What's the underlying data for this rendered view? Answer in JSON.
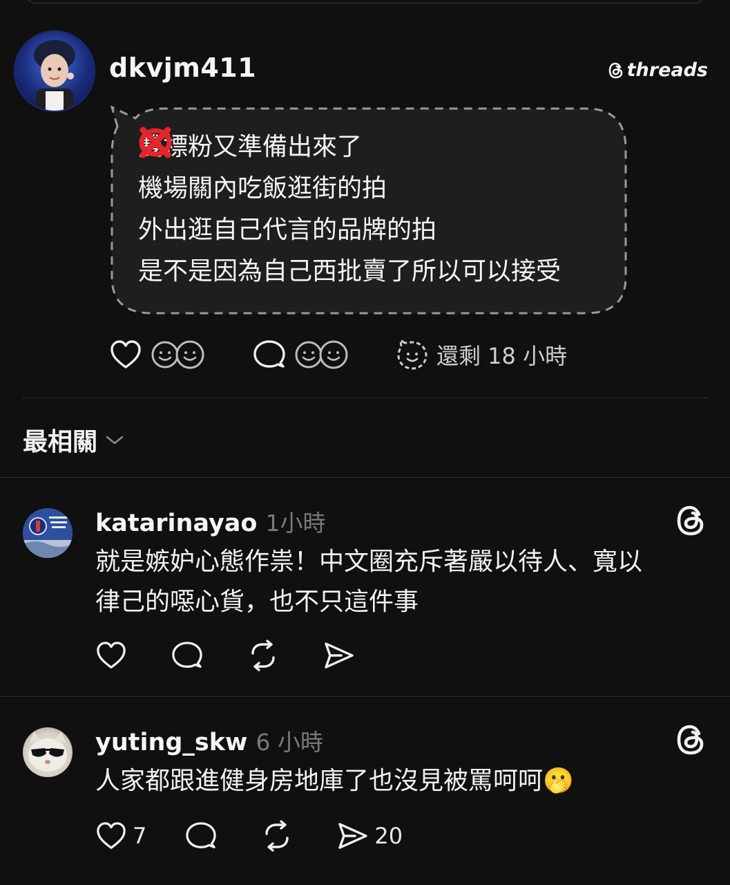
{
  "post": {
    "username": "dkvjm411",
    "brand": "threads",
    "lines": [
      {
        "text": "雙標粉又準備出來了",
        "mark": ""
      },
      {
        "text": "機場關內吃飯逛街的拍",
        "mark": "circle"
      },
      {
        "text": "外出逛自己代言的品牌的拍",
        "mark": "cross"
      },
      {
        "text": "是不是因為自己西批賣了所以可以接受",
        "mark": ""
      }
    ],
    "time_remaining": "還剩 18 小時",
    "icons": [
      "heart-icon",
      "smiley-faces-icon",
      "reply-bubble-icon",
      "smiley-faces-icon",
      "timer-face-icon"
    ]
  },
  "sort": {
    "label": "最相關",
    "icon": "chevron-down-icon"
  },
  "replies": [
    {
      "username": "katarinayao",
      "time": "1小時",
      "lines": [
        "就是嫉妒心態作祟！中文圈充斥著嚴以待人、寬以",
        "律己的噁心貨，也不只這件事"
      ],
      "like_count": "",
      "share_count": ""
    },
    {
      "username": "yuting_skw",
      "time": "6 小時",
      "lines": [
        "人家都跟進健身房地庫了也沒見被罵呵呵🫢"
      ],
      "like_count": "7",
      "share_count": "20"
    }
  ],
  "colors": {
    "background": "#101010",
    "text": "#f3f3f3",
    "muted": "#7a7a7a",
    "circle_mark": "#e5242b",
    "cross_mark": "#e5242b",
    "divider": "#2e2e2e"
  }
}
